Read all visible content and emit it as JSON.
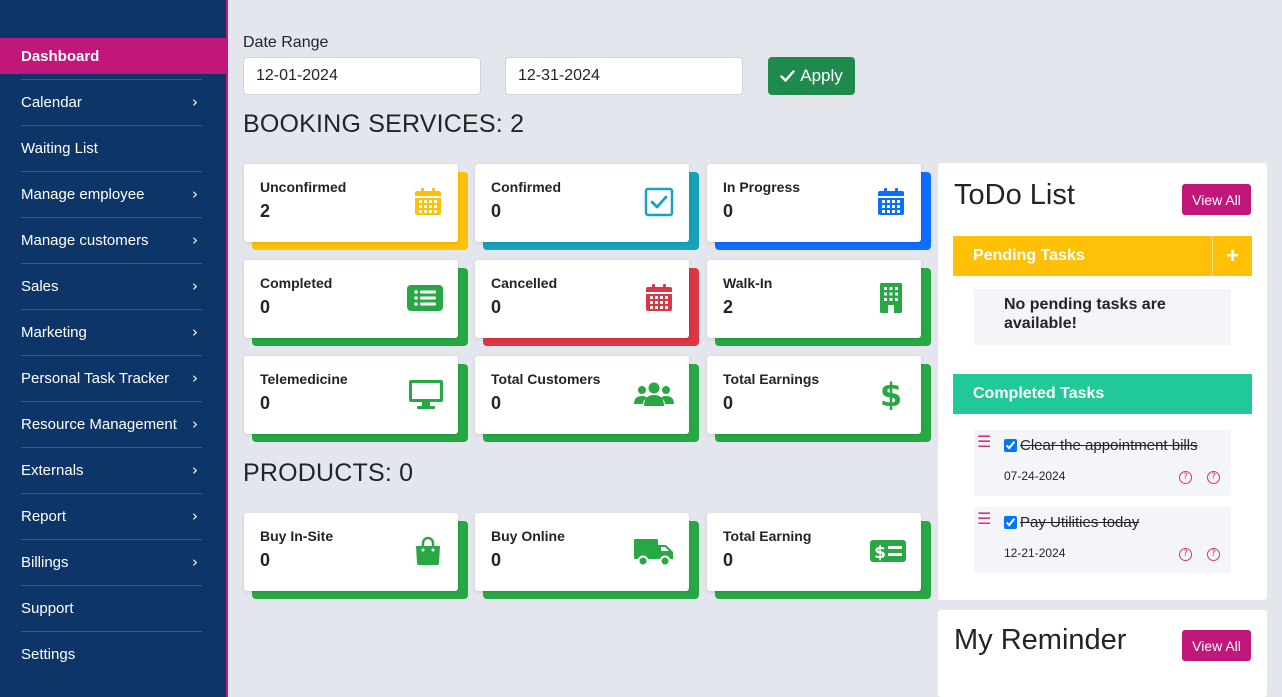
{
  "sidebar": {
    "items": [
      {
        "label": "Dashboard",
        "active": true,
        "chevron": false
      },
      {
        "label": "Calendar",
        "chevron": true
      },
      {
        "label": "Waiting List",
        "chevron": false
      },
      {
        "label": "Manage employee",
        "chevron": true
      },
      {
        "label": "Manage customers",
        "chevron": true
      },
      {
        "label": "Sales",
        "chevron": true
      },
      {
        "label": "Marketing",
        "chevron": true
      },
      {
        "label": "Personal Task Tracker",
        "chevron": true
      },
      {
        "label": "Resource Management",
        "chevron": true
      },
      {
        "label": "Externals",
        "chevron": true
      },
      {
        "label": "Report",
        "chevron": true
      },
      {
        "label": "Billings",
        "chevron": true
      },
      {
        "label": "Support",
        "chevron": false
      },
      {
        "label": "Settings",
        "chevron": false
      }
    ],
    "chevron_glyph": "›"
  },
  "filter": {
    "label": "Date Range",
    "start_date": "12-01-2024",
    "end_date": "12-31-2024",
    "apply_label": "Apply"
  },
  "booking": {
    "title": "BOOKING SERVICES: 2",
    "cards": [
      {
        "label": "Unconfirmed",
        "value": "2",
        "icon": "calendar-icon",
        "color": "#ffc107"
      },
      {
        "label": "Confirmed",
        "value": "0",
        "icon": "checkbox-check-icon",
        "color": "#17a2b8"
      },
      {
        "label": "In Progress",
        "value": "0",
        "icon": "calendar-grid-icon",
        "color": "#0d6efd"
      },
      {
        "label": "Completed",
        "value": "0",
        "icon": "list-icon",
        "color": "#28a745"
      },
      {
        "label": "Cancelled",
        "value": "0",
        "icon": "calendar-cancel-icon",
        "color": "#dc3545"
      },
      {
        "label": "Walk-In",
        "value": "2",
        "icon": "building-icon",
        "color": "#28a745"
      },
      {
        "label": "Telemedicine",
        "value": "0",
        "icon": "monitor-icon",
        "color": "#28a745"
      },
      {
        "label": "Total Customers",
        "value": "0",
        "icon": "users-icon",
        "color": "#28a745"
      },
      {
        "label": "Total Earnings",
        "value": "0",
        "icon": "dollar-icon",
        "color": "#28a745"
      }
    ]
  },
  "products": {
    "title": "PRODUCTS: 0",
    "cards": [
      {
        "label": "Buy In-Site",
        "value": "0",
        "icon": "shopping-bag-icon",
        "color": "#28a745"
      },
      {
        "label": "Buy Online",
        "value": "0",
        "icon": "truck-icon",
        "color": "#28a745"
      },
      {
        "label": "Total Earning",
        "value": "0",
        "icon": "money-bill-icon",
        "color": "#28a745"
      }
    ]
  },
  "todo": {
    "title": "ToDo List",
    "view_all": "View All",
    "pending_label": "Pending Tasks",
    "add_glyph": "+",
    "empty_text": "No pending tasks are available!",
    "completed_label": "Completed Tasks",
    "tasks": [
      {
        "text": "Clear the appointment bills",
        "date": "07-24-2024",
        "checked": true
      },
      {
        "text": "Pay Utilities today",
        "date": "12-21-2024",
        "checked": true
      }
    ],
    "help_glyph": "?",
    "drag_glyph": "☰"
  },
  "reminder": {
    "title": "My Reminder",
    "view_all": "View All"
  },
  "colors": {
    "sidebar_bg": "#0d3568",
    "accent": "#c2177a",
    "apply_green": "#1e8a4e",
    "icon_green": "#28a745",
    "pending_yellow": "#ffc107",
    "completed_teal": "#20c997"
  }
}
